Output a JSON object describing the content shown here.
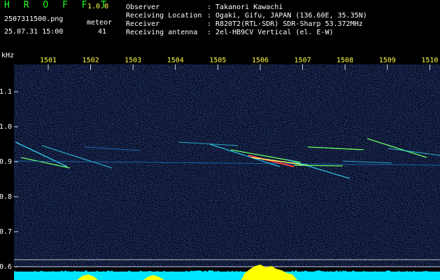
{
  "app": {
    "name": "H R O F F T",
    "version": "1.0.0"
  },
  "file": {
    "name": "2507311500.png",
    "datetime": "25.07.31 15:00"
  },
  "meteor": {
    "label": "meteor",
    "count": "41"
  },
  "info": [
    {
      "key": "Observer",
      "value": ": Takanori Kawachi"
    },
    {
      "key": "Receiving Location",
      "value": ": Ogaki, Gifu, JAPAN (136.60E, 35.35N)"
    },
    {
      "key": "Receiver",
      "value": ": R820T2(RTL-SDR) SDR-Sharp 53.372MHz"
    },
    {
      "key": "Receiving antenna",
      "value": ": 2el-HB9CV Vertical (el. E-W)"
    }
  ],
  "axis": {
    "unit": "kHz",
    "time_labels": [
      "1501",
      "1502",
      "1503",
      "1504",
      "1505",
      "1506",
      "1507",
      "1508",
      "1509",
      "1510"
    ],
    "freq_labels": [
      "1.1",
      "1.0",
      "0.9",
      "0.8",
      "0.7",
      "0.6"
    ]
  },
  "colors": {
    "background": "#000000",
    "noise": "#1a2a8a",
    "trace_cyan": "#33e0ff",
    "trace_green": "#66ff66",
    "trace_hot": "#ff4040",
    "signal_level": "#00e5ff",
    "signal_peak": "#ffff00"
  }
}
